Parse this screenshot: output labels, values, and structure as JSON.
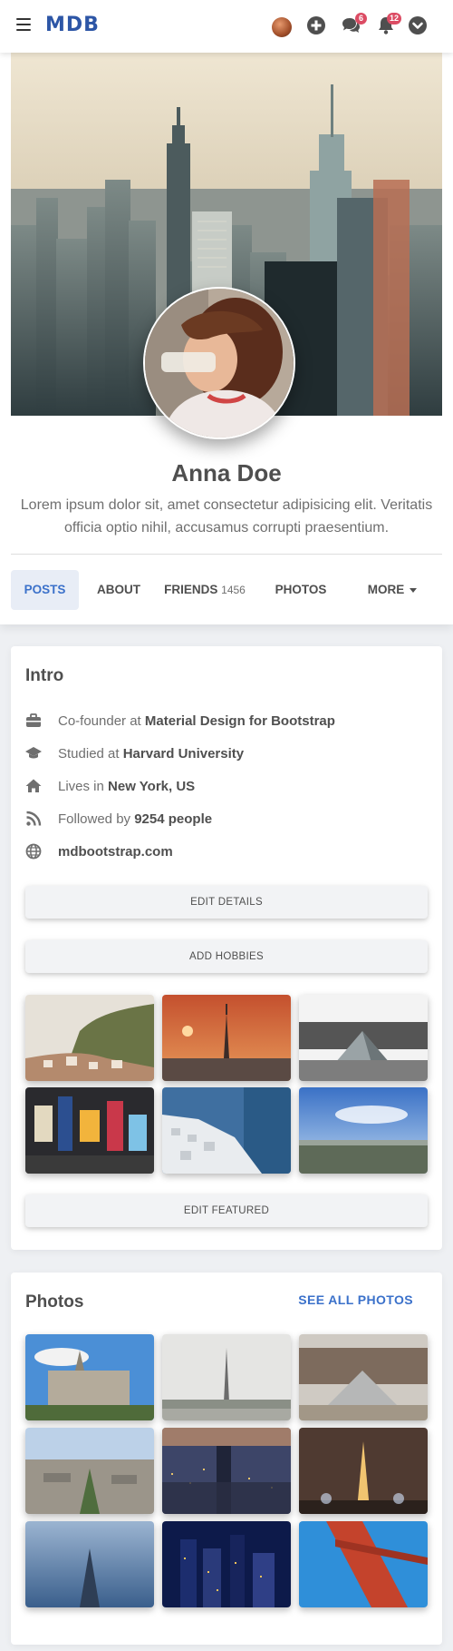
{
  "navbar": {
    "logo": "MDB",
    "icons": [
      "menu-icon",
      "avatar",
      "plus-circle-icon",
      "comments-icon",
      "bell-icon",
      "chevron-down-circle-icon"
    ],
    "messages_badge": "6",
    "notifications_badge": "12",
    "badge_color": "#dc4c64"
  },
  "profile": {
    "name": "Anna Doe",
    "bio": "Lorem ipsum dolor sit, amet consectetur adipisicing elit. Veritatis officia optio nihil, accusamus corrupti praesentium."
  },
  "tabs": {
    "posts": "POSTS",
    "about": "ABOUT",
    "friends": "FRIENDS",
    "friends_count": "1456",
    "photos": "PHOTOS",
    "more": "MORE",
    "active": "POSTS",
    "accent": "#3b71ca"
  },
  "intro": {
    "title": "Intro",
    "work_prefix": "Co-founder at ",
    "work_value": "Material Design for Bootstrap",
    "study_prefix": "Studied at ",
    "study_value": "Harvard University",
    "lives_prefix": "Lives in ",
    "lives_value": "New York, US",
    "followed_prefix": "Followed by ",
    "followed_value": "9254 people",
    "website": "mdbootstrap.com",
    "edit_details": "EDIT DETAILS",
    "add_hobbies": "ADD HOBBIES",
    "edit_featured": "EDIT FEATURED"
  },
  "photos": {
    "title": "Photos",
    "see_all": "SEE ALL PHOTOS"
  }
}
